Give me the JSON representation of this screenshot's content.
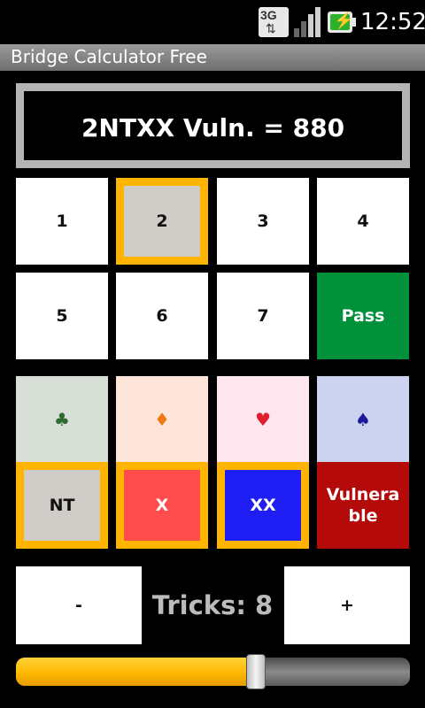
{
  "status_bar": {
    "network_icon": "3g-icon",
    "network_label": "3G",
    "signal_icon": "signal-icon",
    "battery_icon": "battery-charging-icon",
    "time": "12:52"
  },
  "app": {
    "title": "Bridge Calculator Free"
  },
  "display": {
    "text": "2NTXX Vuln. = 880"
  },
  "levels": [
    "1",
    "2",
    "3",
    "4",
    "5",
    "6",
    "7"
  ],
  "selected_level": "2",
  "pass": {
    "label": "Pass",
    "color": "#00913a"
  },
  "suits": [
    {
      "name": "clubs",
      "symbol": "♣",
      "color": "#2e6b2e",
      "bg": "#d7dfd6"
    },
    {
      "name": "diamonds",
      "symbol": "♦",
      "color": "#f07a10",
      "bg": "#fde6d9"
    },
    {
      "name": "hearts",
      "symbol": "♥",
      "color": "#dd1f2e",
      "bg": "#fde6ee"
    },
    {
      "name": "spades",
      "symbol": "♠",
      "color": "#1a1a9a",
      "bg": "#ccd3ef"
    }
  ],
  "modifiers": {
    "nt": {
      "label": "NT",
      "bg": "#d0cdc9",
      "selected": true
    },
    "x": {
      "label": "X",
      "bg": "#ff4c4c",
      "selected": true
    },
    "xx": {
      "label": "XX",
      "bg": "#1f1ff5",
      "selected": true
    },
    "vulnerable": {
      "label": "Vulnerable",
      "bg": "#b40a0a",
      "selected": false
    }
  },
  "tricks": {
    "minus": "-",
    "plus": "+",
    "text": "Tricks: 8",
    "value": 8
  },
  "slider": {
    "fraction": 0.61
  },
  "colors": {
    "selection_border": "#ffb400",
    "slider_fill": "#ffb800"
  }
}
